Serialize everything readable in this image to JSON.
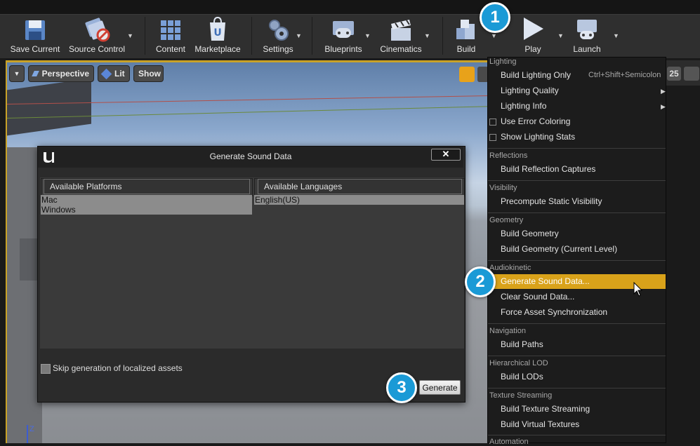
{
  "toolbar": {
    "items": [
      {
        "label": "Save Current",
        "icon": "save-icon"
      },
      {
        "label": "Source Control",
        "icon": "source-control-icon"
      },
      {
        "label": "Content",
        "icon": "content-icon"
      },
      {
        "label": "Marketplace",
        "icon": "marketplace-icon"
      },
      {
        "label": "Settings",
        "icon": "settings-icon"
      },
      {
        "label": "Blueprints",
        "icon": "blueprints-icon"
      },
      {
        "label": "Cinematics",
        "icon": "cinematics-icon"
      },
      {
        "label": "Build",
        "icon": "build-icon"
      },
      {
        "label": "Play",
        "icon": "play-icon"
      },
      {
        "label": "Launch",
        "icon": "launch-icon"
      }
    ]
  },
  "viewport": {
    "perspective_label": "Perspective",
    "lit_label": "Lit",
    "show_label": "Show",
    "grid_value": "25",
    "axis_label": "Z"
  },
  "dialog": {
    "title": "Generate Sound Data",
    "close_glyph": "✕",
    "platforms_header": "Available Platforms",
    "languages_header": "Available Languages",
    "platforms": [
      "Mac",
      "Windows"
    ],
    "languages": [
      "English(US)"
    ],
    "skip_label": "Skip generation of localized assets",
    "skip_checked": false,
    "generate_label": "Generate"
  },
  "menu": {
    "sections": {
      "lighting": "Lighting",
      "reflections": "Reflections",
      "visibility": "Visibility",
      "geometry": "Geometry",
      "audiokinetic": "Audiokinetic",
      "navigation": "Navigation",
      "hlod": "Hierarchical LOD",
      "texture_streaming": "Texture Streaming",
      "automation": "Automation"
    },
    "items": {
      "build_lighting_only": "Build Lighting Only",
      "build_lighting_only_shortcut": "Ctrl+Shift+Semicolon",
      "lighting_quality": "Lighting Quality",
      "lighting_info": "Lighting Info",
      "use_error_coloring": "Use Error Coloring",
      "show_lighting_stats": "Show Lighting Stats",
      "build_reflection_captures": "Build Reflection Captures",
      "precompute_static_visibility": "Precompute Static Visibility",
      "build_geometry": "Build Geometry",
      "build_geometry_current": "Build Geometry (Current Level)",
      "generate_sound_data": "Generate Sound Data...",
      "clear_sound_data": "Clear Sound Data...",
      "force_asset_sync": "Force Asset Synchronization",
      "build_paths": "Build Paths",
      "build_lods": "Build LODs",
      "build_texture_streaming": "Build Texture Streaming",
      "build_virtual_textures": "Build Virtual Textures"
    },
    "highlighted": "Generate Sound Data..."
  },
  "callouts": [
    "1",
    "2",
    "3"
  ],
  "colors": {
    "accent": "#d9a21a",
    "callout": "#1a9ad6",
    "viewport_frame": "#c9a227"
  }
}
